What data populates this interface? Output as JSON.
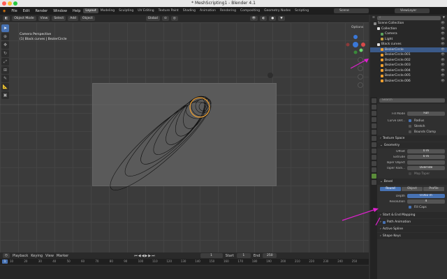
{
  "window": {
    "title": "* MeshScripting1 - Blender 4.1"
  },
  "menu": [
    "File",
    "Edit",
    "Render",
    "Window",
    "Help"
  ],
  "workspaces": [
    "Layout",
    "Modeling",
    "Sculpting",
    "UV Editing",
    "Texture Paint",
    "Shading",
    "Animation",
    "Rendering",
    "Compositing",
    "Geometry Nodes",
    "Scripting"
  ],
  "scene": {
    "label": "Scene",
    "viewlayer": "ViewLayer"
  },
  "viewport_header": {
    "mode": "Object Mode",
    "items": [
      "View",
      "Select",
      "Add",
      "Object"
    ],
    "orientation": "Global"
  },
  "viewport": {
    "line1": "Camera Perspective",
    "line2": "(1) Black curves | BezierCircle",
    "options": "Options"
  },
  "timeline": {
    "items": [
      "Playback",
      "Keying",
      "View",
      "Marker"
    ],
    "current": "1",
    "start_label": "Start",
    "start": "1",
    "end_label": "End",
    "end": "250",
    "ticks": [
      "10",
      "20",
      "30",
      "40",
      "50",
      "60",
      "70",
      "80",
      "90",
      "100",
      "110",
      "120",
      "130",
      "140",
      "150",
      "160",
      "170",
      "180",
      "190",
      "200",
      "210",
      "220",
      "230",
      "240",
      "250"
    ]
  },
  "outliner": {
    "items": [
      {
        "label": "Scene Collection",
        "indent": 0
      },
      {
        "label": "Collection",
        "indent": 1
      },
      {
        "label": "Camera",
        "indent": 2
      },
      {
        "label": "Light",
        "indent": 2
      },
      {
        "label": "Black curves",
        "indent": 1
      },
      {
        "label": "BezierCircle",
        "indent": 2,
        "selected": true
      },
      {
        "label": "BezierCircle.001",
        "indent": 2
      },
      {
        "label": "BezierCircle.002",
        "indent": 2
      },
      {
        "label": "BezierCircle.003",
        "indent": 2
      },
      {
        "label": "BezierCircle.004",
        "indent": 2
      },
      {
        "label": "BezierCircle.005",
        "indent": 2
      },
      {
        "label": "BezierCircle.006",
        "indent": 2
      }
    ]
  },
  "props": {
    "search_placeholder": "Search",
    "fill_mode_label": "Fill Mode",
    "fill_mode": "Full",
    "curve_def_label": "Curve Def...",
    "radius": "Radius",
    "stretch": "Stretch",
    "bounds_clamp": "Bounds Clamp",
    "texture_space": "Texture Space",
    "geometry": "Geometry",
    "offset_label": "Offset",
    "offset": "0 m",
    "extrude_label": "Extrude",
    "extrude": "0 m",
    "taper_object_label": "Taper Object",
    "taper_radius_label": "Taper Radi...",
    "taper_radius": "Override",
    "map_taper": "Map Taper",
    "bevel": "Bevel",
    "bevel_modes": [
      "Round",
      "Object",
      "Profile"
    ],
    "depth_label": "Depth",
    "depth": "0.002 m",
    "resolution_label": "Resolution",
    "resolution": "4",
    "fill_caps": "Fill Caps",
    "start_end": "Start & End Mapping",
    "path_animation": "Path Animation",
    "active_spline": "Active Spline",
    "shape_keys": "Shape Keys"
  },
  "accent": "#4772b3",
  "arrow_color": "#e020d0"
}
